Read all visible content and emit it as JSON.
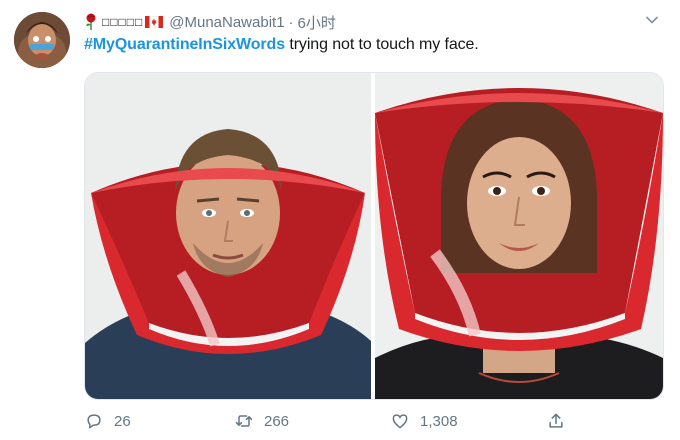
{
  "tweet": {
    "display_name": "□□□□□",
    "handle": "@MunaNawabit1",
    "separator": "·",
    "time": "6小时",
    "hashtag": "#MyQuarantineInSixWords",
    "body": " trying not to touch my face."
  },
  "actions": {
    "reply_count": "26",
    "retweet_count": "266",
    "like_count": "1,308"
  },
  "icons": {
    "avatar": "avatar-image",
    "name_emoji": "rose-icon",
    "flag": "canada-flag-icon",
    "menu": "chevron-down-icon",
    "reply": "reply-icon",
    "retweet": "retweet-icon",
    "like": "heart-icon",
    "share": "share-icon"
  },
  "colors": {
    "hashtag": "#1b95e0",
    "secondary_text": "#657786",
    "cone_red": "#d9292f"
  }
}
